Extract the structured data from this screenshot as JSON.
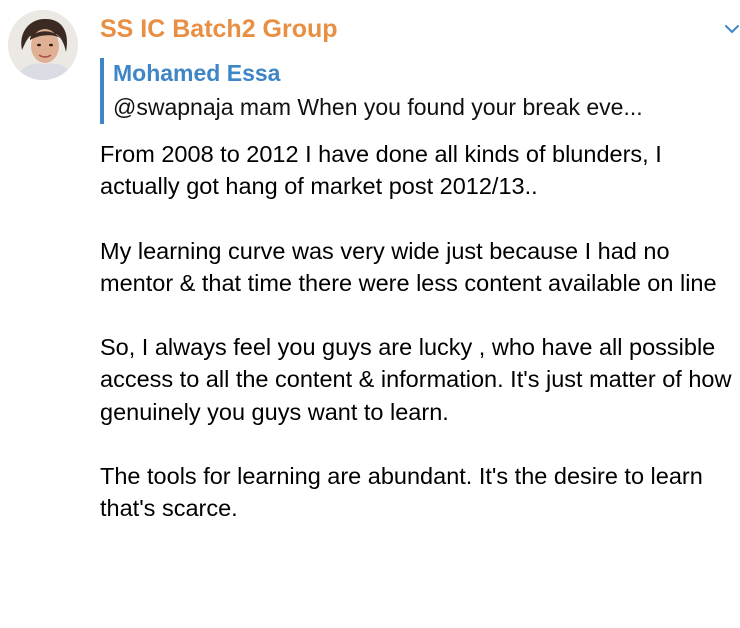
{
  "chat": {
    "group_name": "SS IC Batch2 Group",
    "accent_color": "#e88f44"
  },
  "reply": {
    "author": "Mohamed Essa",
    "preview": "@swapnaja mam When you found your break eve...",
    "accent_color": "#3f86c7"
  },
  "message": {
    "paragraphs": [
      "From 2008 to 2012 I have done all kinds of blunders, I actually got hang of market post 2012/13..",
      "My learning curve was very wide just because I had no mentor & that time there were less content available on line",
      "So, I always feel  you guys are lucky , who have all possible access to all the content & information. It's just matter of how genuinely you guys want to learn.",
      "The tools for learning are abundant. It's the desire to learn that's scarce."
    ]
  },
  "icons": {
    "avatar": "profile-photo",
    "chevron": "chevron-down-icon"
  }
}
